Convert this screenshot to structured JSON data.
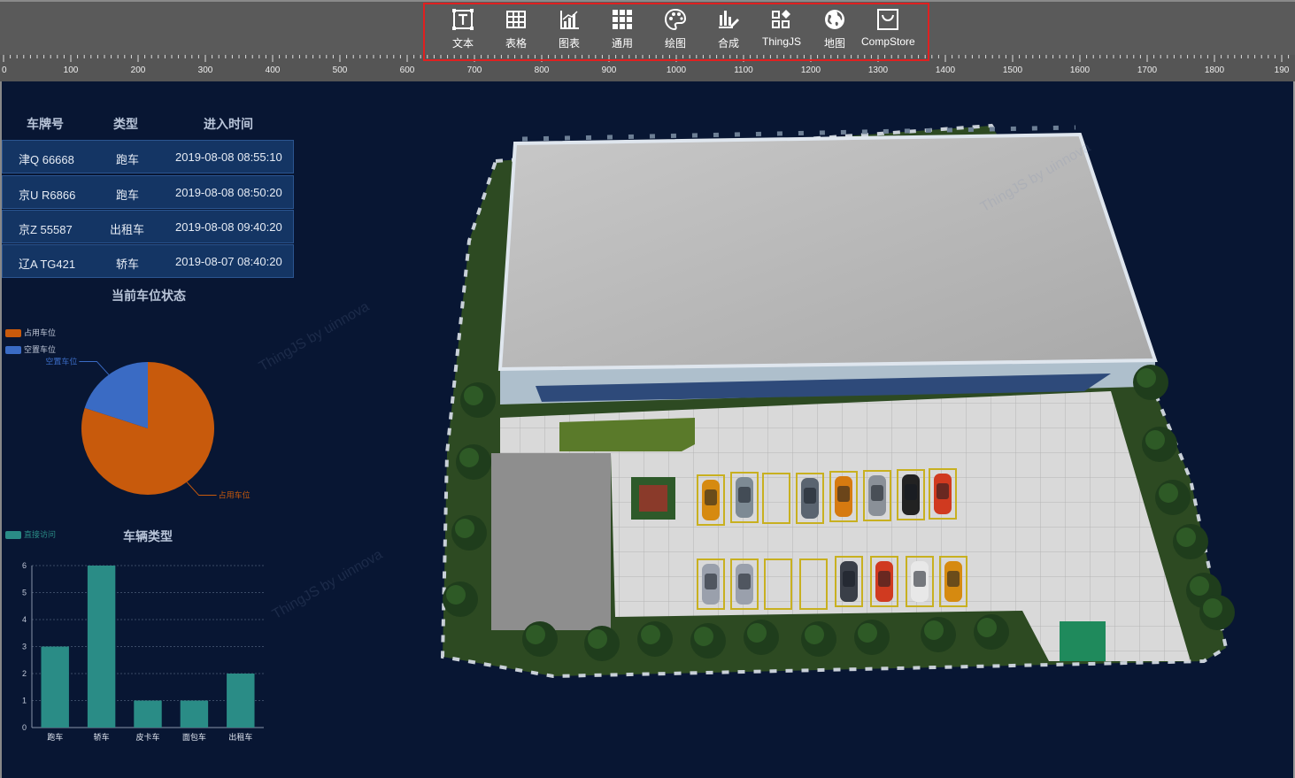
{
  "toolbar": {
    "items": [
      {
        "label": "文本",
        "icon": "text-box-icon"
      },
      {
        "label": "表格",
        "icon": "table-icon"
      },
      {
        "label": "图表",
        "icon": "chart-icon"
      },
      {
        "label": "通用",
        "icon": "grid-icon"
      },
      {
        "label": "绘图",
        "icon": "palette-icon"
      },
      {
        "label": "合成",
        "icon": "compose-icon"
      },
      {
        "label": "ThingJS",
        "icon": "shapes-icon"
      },
      {
        "label": "地图",
        "icon": "globe-icon"
      },
      {
        "label": "CompStore",
        "icon": "store-bag-icon"
      }
    ],
    "highlight_color": "#e02020"
  },
  "ruler": {
    "labels": [
      "0",
      "100",
      "200",
      "300",
      "400",
      "500",
      "600",
      "700",
      "800",
      "900",
      "1000",
      "1100",
      "1200",
      "1300",
      "1400",
      "1500",
      "1600",
      "1700",
      "1800",
      "190"
    ]
  },
  "table": {
    "headers": [
      "车牌号",
      "类型",
      "进入时间"
    ],
    "rows": [
      [
        "津Q 66668",
        "跑车",
        "2019-08-08 08:55:10"
      ],
      [
        "京U R6866",
        "跑车",
        "2019-08-08 08:50:20"
      ],
      [
        "京Z 55587",
        "出租车",
        "2019-08-08 09:40:20"
      ],
      [
        "辽A TG421",
        "轿车",
        "2019-08-07 08:40:20"
      ]
    ]
  },
  "status_chart": {
    "title": "当前车位状态",
    "legend": [
      {
        "name": "占用车位",
        "color": "#c85a0c"
      },
      {
        "name": "空置车位",
        "color": "#3a6bc4"
      }
    ],
    "slice_labels": {
      "occupied": "占用车位",
      "empty": "空置车位"
    }
  },
  "type_chart": {
    "title": "车辆类型",
    "legend": "直接访问",
    "color": "#2a8c86"
  },
  "watermark": "ThingJS by uinnova",
  "chart_data": [
    {
      "type": "pie",
      "title": "当前车位状态",
      "labels": [
        "占用车位",
        "空置车位"
      ],
      "values": [
        80,
        20
      ],
      "colors": [
        "#c85a0c",
        "#3a6bc4"
      ]
    },
    {
      "type": "bar",
      "title": "车辆类型",
      "categories": [
        "跑车",
        "轿车",
        "皮卡车",
        "面包车",
        "出租车"
      ],
      "series": [
        {
          "name": "直接访问",
          "values": [
            3,
            6,
            1,
            1,
            2
          ]
        }
      ],
      "ylim": [
        0,
        6
      ],
      "yticks": [
        0,
        1,
        2,
        3,
        4,
        5,
        6
      ],
      "grid": true,
      "legend_position": "top-left"
    }
  ]
}
